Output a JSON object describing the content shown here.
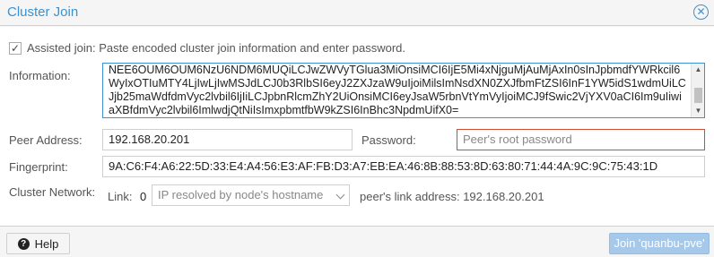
{
  "dialog": {
    "title": "Cluster Join",
    "close_icon": "close-icon"
  },
  "form": {
    "assisted_join": {
      "label": "Assisted join: Paste encoded cluster join information and enter password.",
      "checked": true
    },
    "information": {
      "label": "Information:",
      "value": "NEE6OUM6OUM6NzU6NDM6MUQiLCJwZWVyTGlua3MiOnsiMCI6IjE5Mi4xNjguMjAuMjAxIn0sInJpbmdfYWRkcil6WyIxOTIuMTY4LjIwLjIwMSJdLCJ0b3RlbSI6eyJ2ZXJzaW9uIjoiMilsImNsdXN0ZXJfbmFtZSI6InF1YW5idS1wdmUiLCJjb25maWdfdmVyc2lvbil6IjIiLCJpbnRlcmZhY2UiOnsiMCI6eyJsaW5rbnVtYmVyIjoiMCJ9fSwic2VjYXV0aCI6Im9uIiwiaXBfdmVyc2lvbil6ImlwdjQtNiIsImxpbmtfbW9kZSI6InBhc3NpdmUifX0="
    },
    "peer_address": {
      "label": "Peer Address:",
      "value": "192.168.20.201"
    },
    "password": {
      "label": "Password:",
      "placeholder": "Peer's root password",
      "value": ""
    },
    "fingerprint": {
      "label": "Fingerprint:",
      "value": "9A:C6:F4:A6:22:5D:33:E4:A4:56:E3:AF:FB:D3:A7:EB:EA:46:8B:88:53:8D:63:80:71:44:4A:9C:9C:75:43:1D"
    },
    "cluster_network": {
      "label": "Cluster Network:",
      "link_label": "Link:",
      "link_number": "0",
      "select_placeholder": "IP resolved by node's hostname",
      "peer_link_text": "peer's link address: 192.168.20.201"
    }
  },
  "footer": {
    "help_label": "Help",
    "join_label": "Join 'quanbu-pve'"
  },
  "colors": {
    "accent": "#3892d4",
    "invalid_border": "#cf4c35",
    "join_button_disabled": "#a6c9ea"
  }
}
